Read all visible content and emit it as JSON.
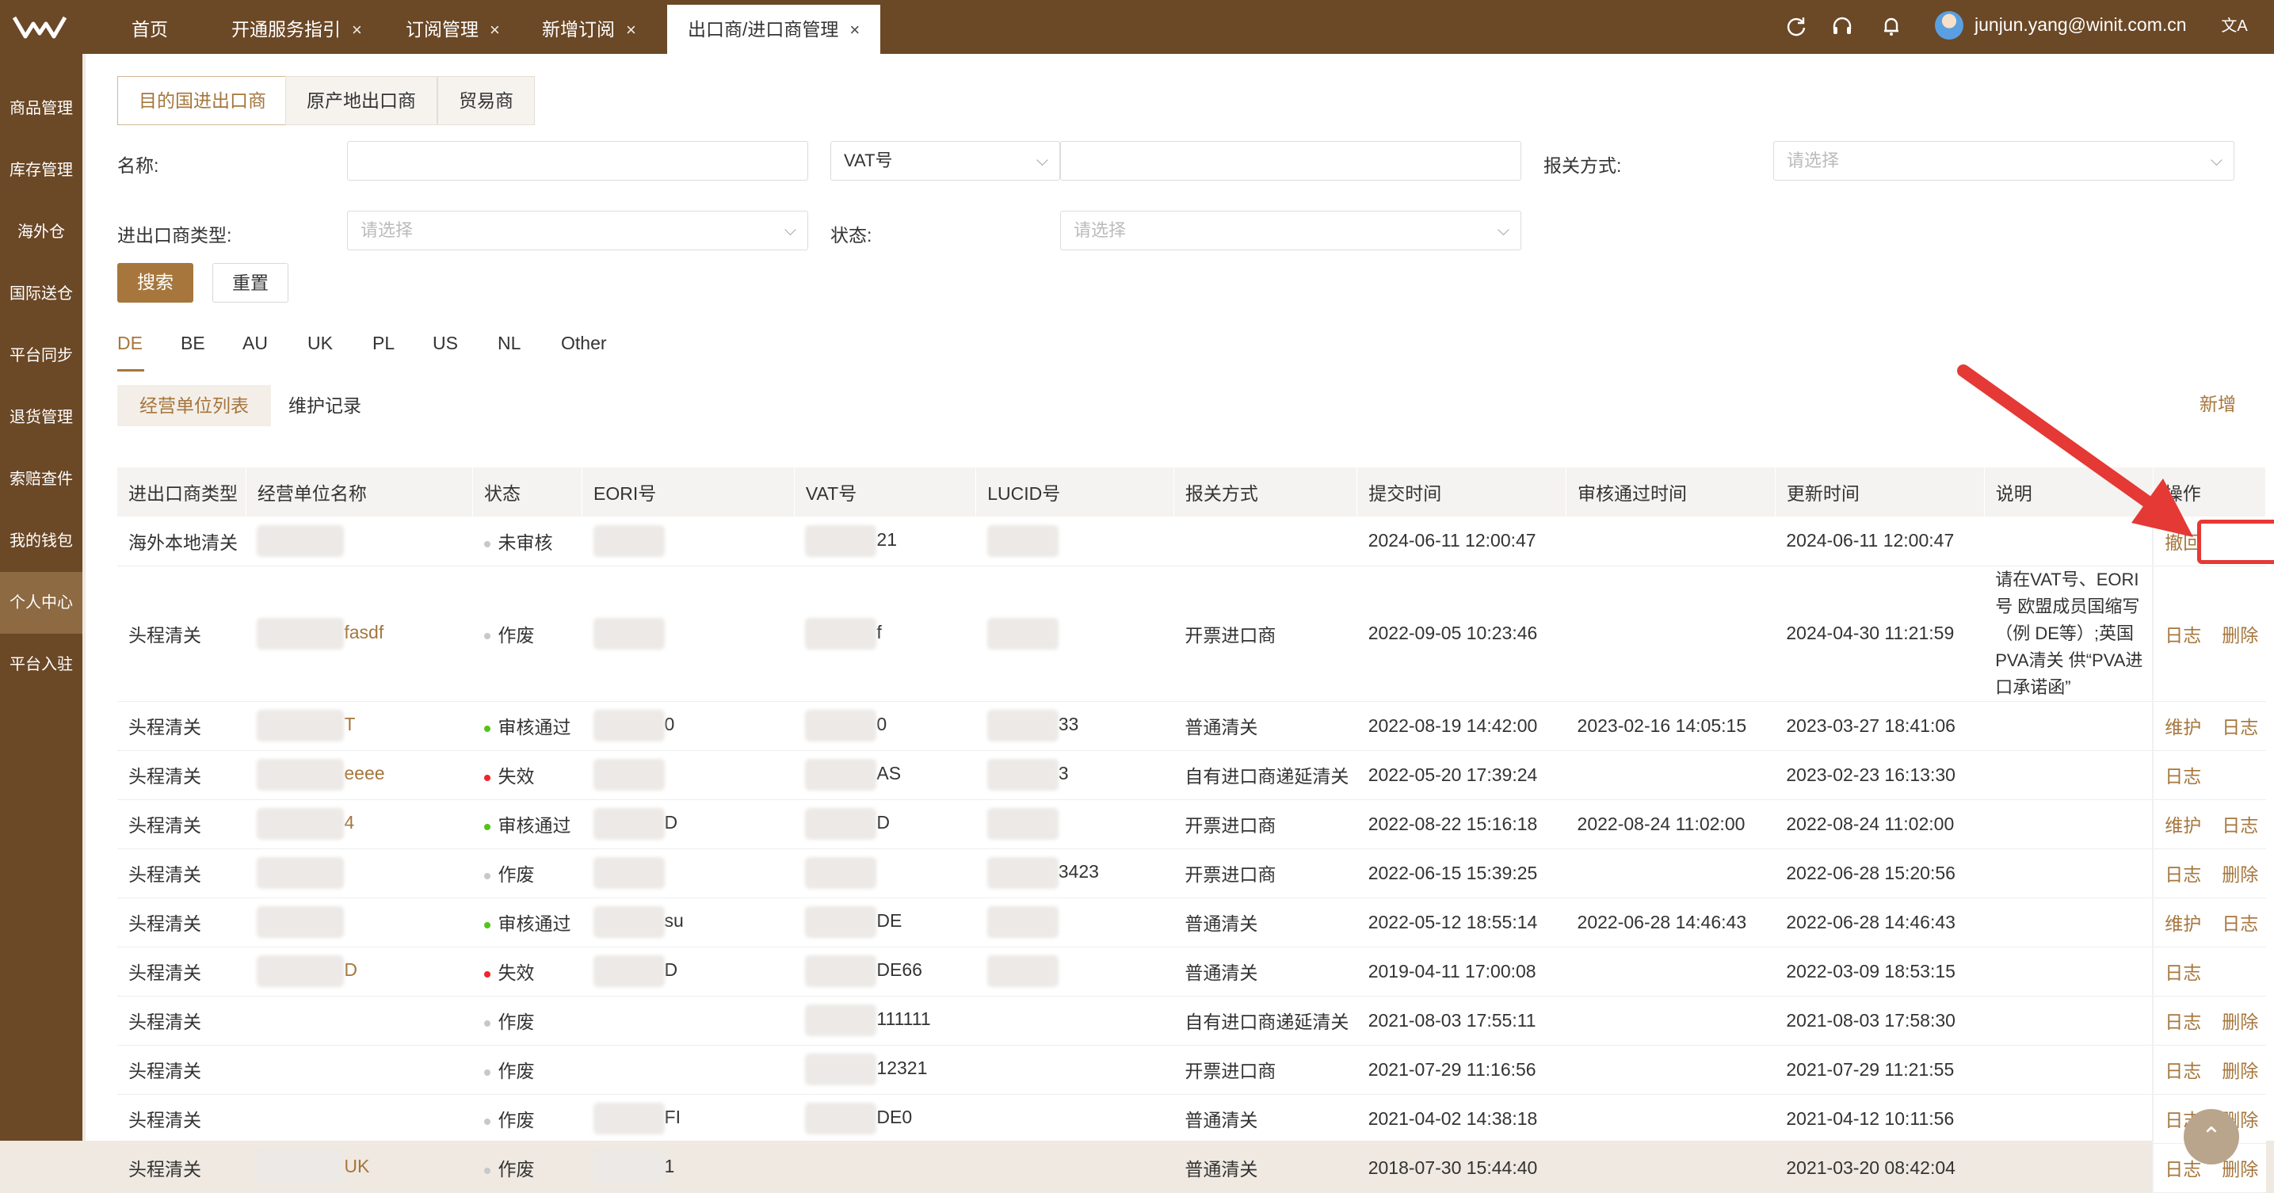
{
  "tabs": [
    {
      "label": "首页",
      "closable": false
    },
    {
      "label": "开通服务指引",
      "closable": true
    },
    {
      "label": "订阅管理",
      "closable": true
    },
    {
      "label": "新增订阅",
      "closable": true
    },
    {
      "label": "出口商/进口商管理",
      "closable": true,
      "active": true
    }
  ],
  "header": {
    "user_email": "junjun.yang@winit.com.cn",
    "icons": [
      "refresh-icon",
      "headset-icon",
      "bell-icon",
      "translate-icon"
    ],
    "close_glyph": "×",
    "translate_glyph": "文A"
  },
  "sidebar": [
    "商品管理",
    "库存管理",
    "海外仓",
    "国际送仓",
    "平台同步",
    "退货管理",
    "索赔查件",
    "我的钱包",
    "个人中心",
    "平台入驻"
  ],
  "sidebar_active": "个人中心",
  "type_tabs": [
    "目的国进出口商",
    "原产地出口商",
    "贸易商"
  ],
  "filters": {
    "name_label": "名称:",
    "vat_select": "VAT号",
    "customs_label": "报关方式:",
    "customs_placeholder": "请选择",
    "type_label": "进出口商类型:",
    "type_placeholder": "请选择",
    "status_label": "状态:",
    "status_placeholder": "请选择",
    "search_btn": "搜索",
    "reset_btn": "重置"
  },
  "countries": [
    "DE",
    "BE",
    "AU",
    "UK",
    "PL",
    "US",
    "NL",
    "Other"
  ],
  "active_country": "DE",
  "sub_tabs": [
    "经营单位列表",
    "维护记录"
  ],
  "add_link": "新增",
  "columns": [
    "进出口商类型",
    "经营单位名称",
    "状态",
    "EORI号",
    "VAT号",
    "LUCID号",
    "报关方式",
    "提交时间",
    "审核通过时间",
    "更新时间",
    "说明",
    "操作"
  ],
  "rows": [
    {
      "type": "海外本地清关",
      "name": "",
      "status": "未审核",
      "status_color": "#c8c8c8",
      "eori": "",
      "vat": "21",
      "lucid": "",
      "customs": "",
      "submit": "2024-06-11 12:00:47",
      "approved": "",
      "updated": "2024-06-11 12:00:47",
      "note": "",
      "ops": [
        "撤回"
      ]
    },
    {
      "type": "头程清关",
      "name": "fasdf",
      "status": "作废",
      "status_color": "#c8c8c8",
      "eori": "",
      "vat": "f",
      "lucid": "",
      "customs": "开票进口商",
      "submit": "2022-09-05 10:23:46",
      "approved": "",
      "updated": "2024-04-30 11:21:59",
      "note": "请在VAT号、EORI号 欧盟成员国缩写（例 DE等）;英国PVA清关 供“PVA进口承诺函”",
      "ops": [
        "日志",
        "删除"
      ]
    },
    {
      "type": "头程清关",
      "name": "T",
      "status": "审核通过",
      "status_color": "#52c41a",
      "eori": "0",
      "vat": "0",
      "lucid": "33",
      "customs": "普通清关",
      "submit": "2022-08-19 14:42:00",
      "approved": "2023-02-16 14:05:15",
      "updated": "2023-03-27 18:41:06",
      "note": "",
      "ops": [
        "维护",
        "日志"
      ]
    },
    {
      "type": "头程清关",
      "name": "eeee",
      "status": "失效",
      "status_color": "#f5222d",
      "eori": "",
      "vat": "AS",
      "lucid": "3",
      "customs": "自有进口商递延清关",
      "submit": "2022-05-20 17:39:24",
      "approved": "",
      "updated": "2023-02-23 16:13:30",
      "note": "",
      "ops": [
        "日志"
      ]
    },
    {
      "type": "头程清关",
      "name": "4",
      "status": "审核通过",
      "status_color": "#52c41a",
      "eori": "D",
      "vat": "D",
      "lucid": "",
      "customs": "开票进口商",
      "submit": "2022-08-22 15:16:18",
      "approved": "2022-08-24 11:02:00",
      "updated": "2022-08-24 11:02:00",
      "note": "",
      "ops": [
        "维护",
        "日志"
      ]
    },
    {
      "type": "头程清关",
      "name": "",
      "status": "作废",
      "status_color": "#c8c8c8",
      "eori": "",
      "vat": "",
      "lucid": "3423",
      "customs": "开票进口商",
      "submit": "2022-06-15 15:39:25",
      "approved": "",
      "updated": "2022-06-28 15:20:56",
      "note": "",
      "ops": [
        "日志",
        "删除"
      ]
    },
    {
      "type": "头程清关",
      "name": "",
      "status": "审核通过",
      "status_color": "#52c41a",
      "eori": "su",
      "vat": "DE",
      "lucid": "",
      "customs": "普通清关",
      "submit": "2022-05-12 18:55:14",
      "approved": "2022-06-28 14:46:43",
      "updated": "2022-06-28 14:46:43",
      "note": "",
      "ops": [
        "维护",
        "日志"
      ]
    },
    {
      "type": "头程清关",
      "name": "D",
      "status": "失效",
      "status_color": "#f5222d",
      "eori": "D",
      "vat": "DE66",
      "lucid": "",
      "customs": "普通清关",
      "submit": "2019-04-11 17:00:08",
      "approved": "",
      "updated": "2022-03-09 18:53:15",
      "note": "",
      "ops": [
        "日志"
      ]
    },
    {
      "type": "头程清关",
      "name": "",
      "status": "作废",
      "status_color": "#c8c8c8",
      "eori": "",
      "vat": "111111",
      "lucid": "",
      "customs": "自有进口商递延清关",
      "submit": "2021-08-03 17:55:11",
      "approved": "",
      "updated": "2021-08-03 17:58:30",
      "note": "",
      "ops": [
        "日志",
        "删除"
      ]
    },
    {
      "type": "头程清关",
      "name": "",
      "status": "作废",
      "status_color": "#c8c8c8",
      "eori": "",
      "vat": "12321",
      "lucid": "",
      "customs": "开票进口商",
      "submit": "2021-07-29 11:16:56",
      "approved": "",
      "updated": "2021-07-29 11:21:55",
      "note": "",
      "ops": [
        "日志",
        "删除"
      ]
    },
    {
      "type": "头程清关",
      "name": "",
      "status": "作废",
      "status_color": "#c8c8c8",
      "eori": "FI",
      "vat": "DE0",
      "lucid": "",
      "customs": "普通清关",
      "submit": "2021-04-02 14:38:18",
      "approved": "",
      "updated": "2021-04-12 10:11:56",
      "note": "",
      "ops": [
        "日志",
        "删除"
      ]
    },
    {
      "type": "头程清关",
      "name": "UK",
      "status": "作废",
      "status_color": "#c8c8c8",
      "eori": "1",
      "vat": "",
      "lucid": "",
      "customs": "普通清关",
      "submit": "2018-07-30 15:44:40",
      "approved": "",
      "updated": "2021-03-20 08:42:04",
      "note": "",
      "ops": [
        "日志",
        "删除"
      ]
    }
  ],
  "colors": {
    "brand": "#6b4826",
    "accent": "#a6763c",
    "annotation": "#e53935"
  }
}
